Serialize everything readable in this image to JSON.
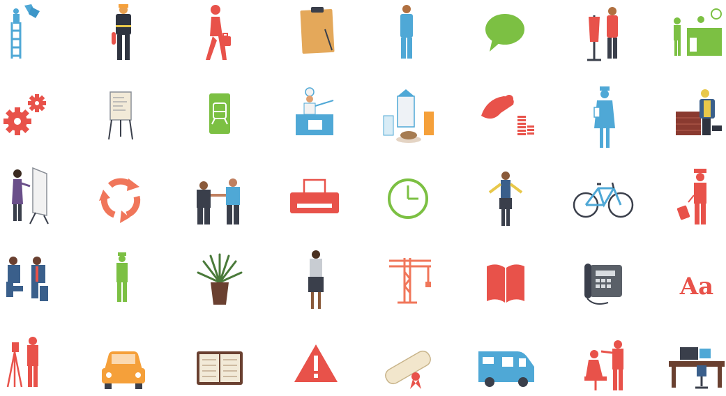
{
  "colors": {
    "blue": "#4fa8d6",
    "red": "#e8524a",
    "green": "#7cc043",
    "orange": "#f5a03a",
    "tan": "#e4a85a",
    "dark": "#3a3f4b",
    "gray": "#8a8f97"
  },
  "icons": [
    [
      "window-cleaner-icon",
      "firefighter-icon",
      "commuter-icon",
      "clipboard-icon",
      "worker-icon",
      "speech-bubble-icon",
      "tailor-icon",
      "reception-desk-icon"
    ],
    [
      "gears-icon",
      "flipchart-icon",
      "train-ticket-icon",
      "chef-icon",
      "breakfast-icon",
      "coins-icon",
      "nurse-icon",
      "bricklayer-icon"
    ],
    [
      "painter-icon",
      "recycle-icon",
      "handshake-icon",
      "printer-icon",
      "clock-icon",
      "flight-attendant-icon",
      "bicycle-icon",
      "pilot-luggage-icon"
    ],
    [
      "mechanics-icon",
      "surveyor-icon",
      "potted-plant-icon",
      "businesswoman-icon",
      "crane-icon",
      "book-icon",
      "telephone-icon",
      "typography-icon"
    ],
    [
      "theodolite-icon",
      "car-icon",
      "organizer-icon",
      "warning-icon",
      "diploma-icon",
      "van-icon",
      "hairdresser-icon",
      "office-desk-icon"
    ]
  ],
  "typography_text": "Aa"
}
